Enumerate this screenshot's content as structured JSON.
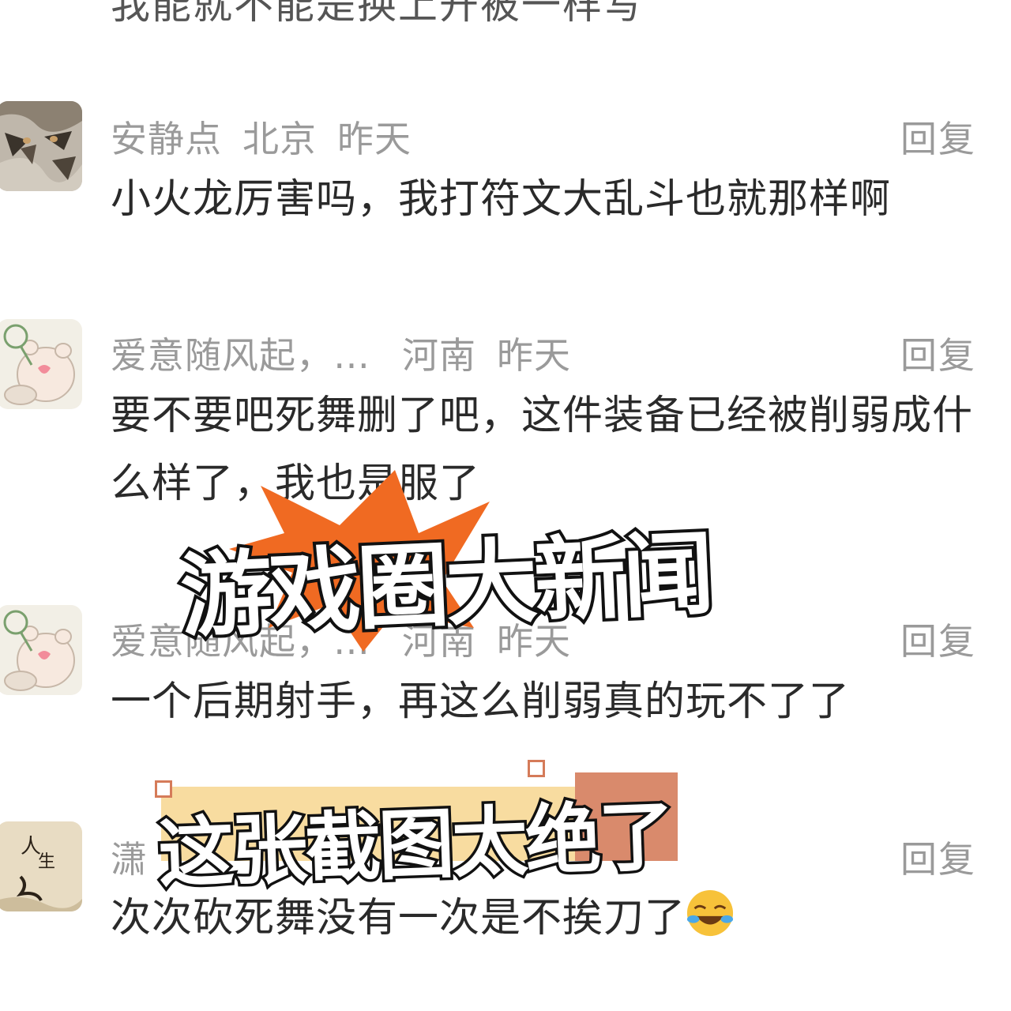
{
  "top_cut_text": "我能就不能是换上开被一样写",
  "comments": [
    {
      "username": "安静点",
      "location": "北京",
      "time": "昨天",
      "reply": "回复",
      "lines": [
        "小火龙厉害吗，我打符文大乱斗也就那样啊"
      ],
      "avatar": "tiger-avatar"
    },
    {
      "username": "爱意随风起，…",
      "location": "河南",
      "time": "昨天",
      "reply": "回复",
      "lines": [
        "要不要吧死舞删了吧，这件装备已经被削弱成什",
        "么样了，我也是服了"
      ],
      "avatar": "bear-avatar"
    },
    {
      "username": "爱意随风起，…",
      "location": "河南",
      "time": "昨天",
      "reply": "回复",
      "lines": [
        "一个后期射手，再这么削弱真的玩不了了"
      ],
      "avatar": "bear-avatar"
    },
    {
      "username": "潇",
      "location": "",
      "time": "",
      "reply": "回复",
      "lines": [
        "次次砍死舞没有一次是不挨刀了"
      ],
      "avatar": "calligraphy-avatar",
      "emoji": "laughing-crying-emoji"
    }
  ],
  "stickers": {
    "news": "游戏圈大新闻",
    "screenshot": "这张截图太绝了"
  },
  "calligraphy_avatar_text": "人生"
}
